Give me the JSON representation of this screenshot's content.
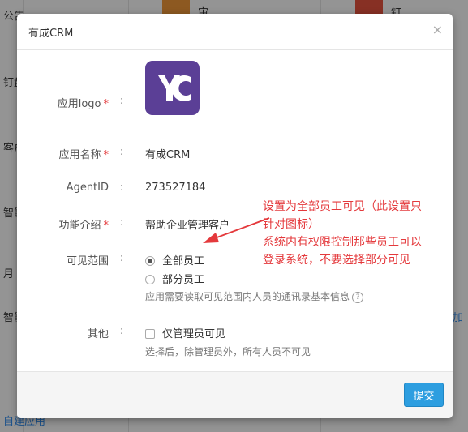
{
  "background": {
    "left_items": [
      "公告",
      "钉盘",
      "客户",
      "智能",
      "月",
      "智能"
    ],
    "bottom_link": "自建应用",
    "tile_1_label": "审批",
    "tile_2_label": "钉邮",
    "right_link": "加"
  },
  "modal": {
    "title": "有成CRM",
    "close_glyph": "×",
    "fields": {
      "logo": {
        "label": "应用logo",
        "required_mark": "*",
        "colon": ":"
      },
      "name": {
        "label": "应用名称",
        "required_mark": "*",
        "colon": ":",
        "value": "有成CRM"
      },
      "agent_id": {
        "label": "AgentID",
        "colon": ":",
        "value": "273527184"
      },
      "intro": {
        "label": "功能介绍",
        "required_mark": "*",
        "colon": ":",
        "value": "帮助企业管理客户"
      },
      "scope": {
        "label": "可见范围",
        "colon": ":",
        "options": [
          {
            "label": "全部员工",
            "checked": true
          },
          {
            "label": "部分员工",
            "checked": false
          }
        ],
        "hint": "应用需要读取可见范围内人员的通讯录基本信息",
        "help_glyph": "?"
      },
      "other": {
        "label": "其他",
        "colon": ":",
        "checkbox_label": "仅管理员可见",
        "checked": false,
        "hint": "选择后，除管理员外，所有人员不可见"
      }
    },
    "submit_label": "提交"
  },
  "annotation": {
    "lines": [
      "设置为全部员工可见（此设置只",
      "针对图标）",
      "系统内有权限控制那些员工可以",
      "登录系统，不要选择部分可见"
    ]
  },
  "colors": {
    "logo_bg": "#5b3f96",
    "accent": "#2d9ee0",
    "required": "#e4393c",
    "annotation": "#e4393c",
    "overlay": "rgba(0,0,0,0.42)",
    "tile_1": "#f39a3a",
    "tile_2": "#e8533f"
  }
}
